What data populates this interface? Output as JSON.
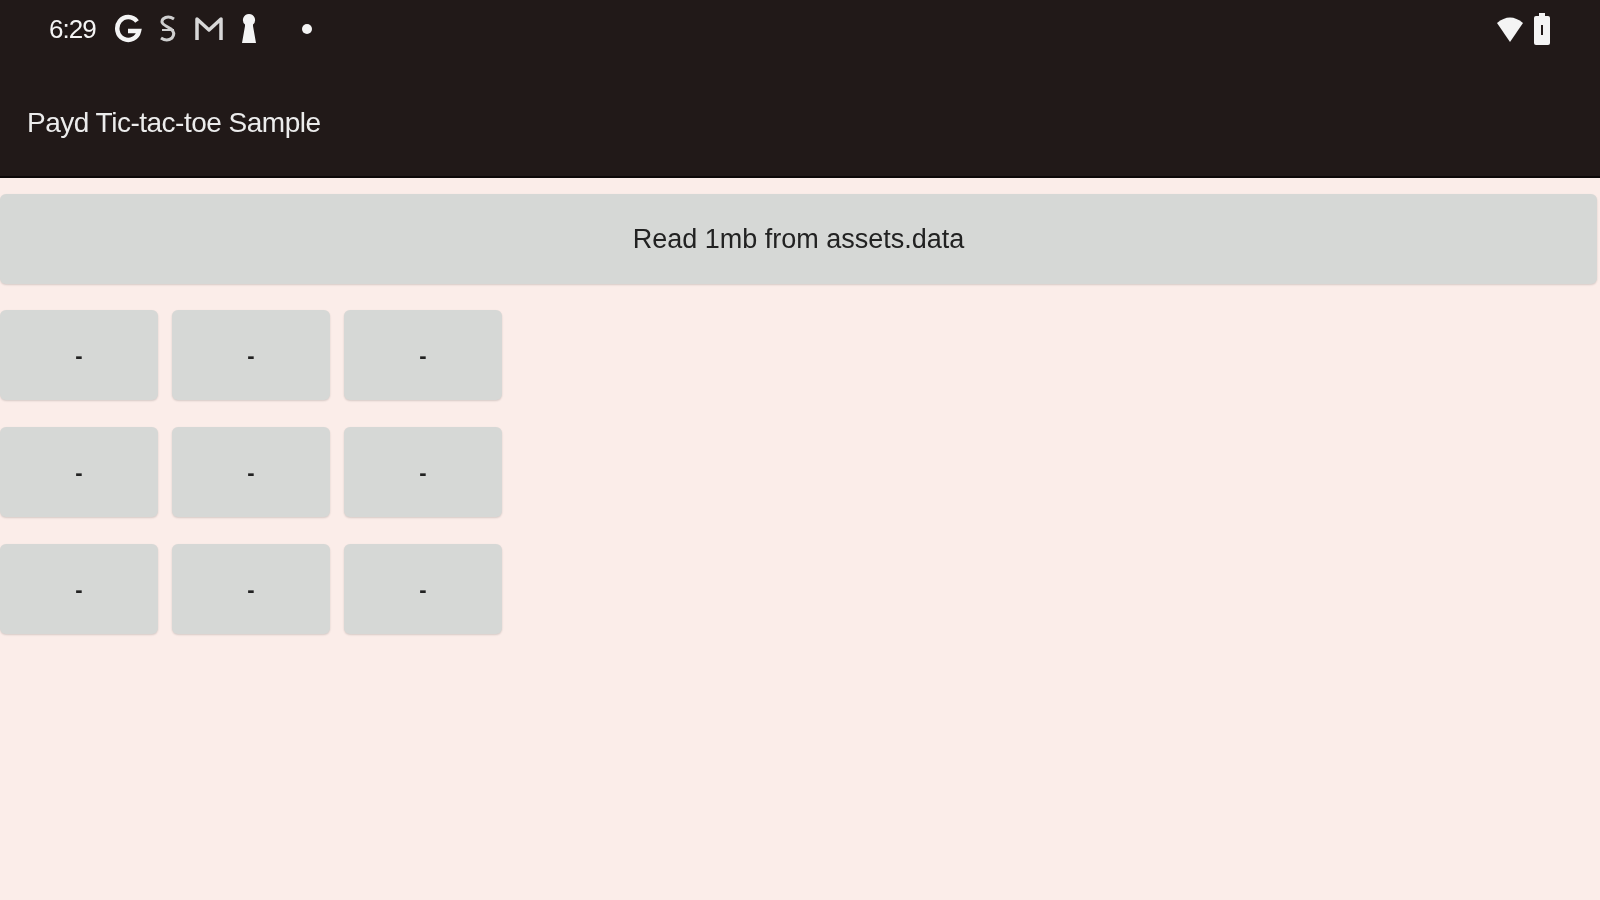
{
  "status_bar": {
    "time": "6:29"
  },
  "app_bar": {
    "title": "Payd Tic-tac-toe Sample"
  },
  "read_button": {
    "label": "Read 1mb from assets.data"
  },
  "board": {
    "rows": [
      [
        "-",
        "-",
        "-"
      ],
      [
        "-",
        "-",
        "-"
      ],
      [
        "-",
        "-",
        "-"
      ]
    ]
  }
}
